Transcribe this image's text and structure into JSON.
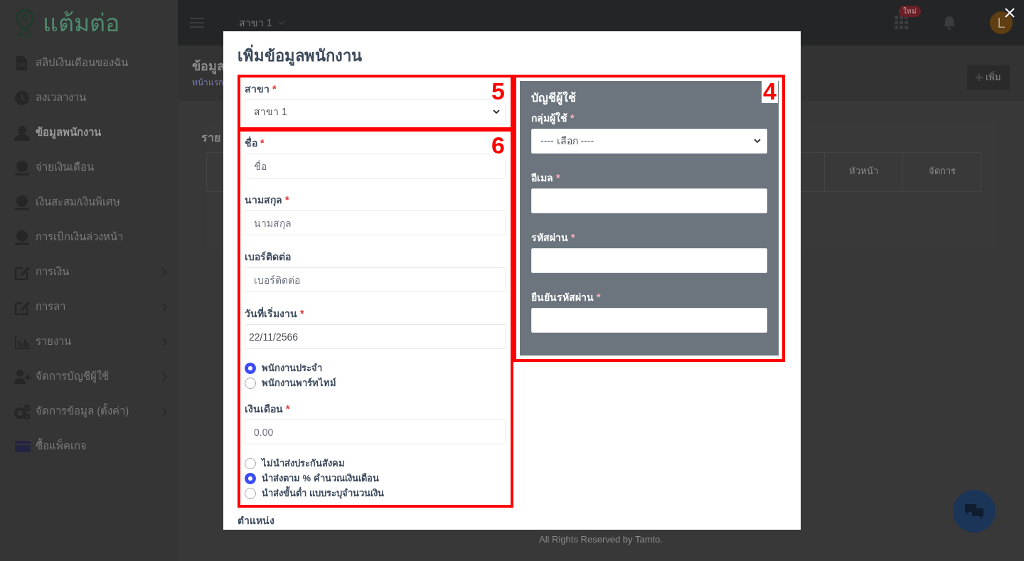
{
  "sidebar": {
    "logo": "แต้มต่อ",
    "items": [
      {
        "label": "สลิปเงินเดือนของฉัน",
        "kind": "document",
        "selected": false,
        "has_submenu": false
      },
      {
        "label": "ลงเวลางาน",
        "kind": "clock",
        "selected": false,
        "has_submenu": false
      },
      {
        "label": "ข้อมูลพนักงาน",
        "kind": "user",
        "selected": true,
        "has_submenu": false
      },
      {
        "label": "จ่ายเงินเดือน",
        "kind": "money",
        "selected": false,
        "has_submenu": false
      },
      {
        "label": "เงินสะสม/เงินพิเศษ",
        "kind": "money",
        "selected": false,
        "has_submenu": false
      },
      {
        "label": "การเบิกเงินล่วงหน้า",
        "kind": "money",
        "selected": false,
        "has_submenu": false
      },
      {
        "label": "การเงิน",
        "kind": "edit",
        "selected": false,
        "has_submenu": true
      },
      {
        "label": "การลา",
        "kind": "edit",
        "selected": false,
        "has_submenu": true
      },
      {
        "label": "รายงาน",
        "kind": "chart",
        "selected": false,
        "has_submenu": true
      },
      {
        "label": "จัดการบัญชีผู้ใช้",
        "kind": "user-plus",
        "selected": false,
        "has_submenu": true
      },
      {
        "label": "จัดการข้อมูล (ตั้งค่า)",
        "kind": "gears",
        "selected": false,
        "has_submenu": true
      },
      {
        "label": "ซื้อแพ็คเกจ",
        "kind": "card",
        "selected": false,
        "has_submenu": false
      }
    ]
  },
  "header": {
    "branch": "สาขา 1",
    "apps_badge": "ใหม่",
    "avatar": "L"
  },
  "page": {
    "title": "ข้อมูล",
    "breadcrumb": "หน้าแรก",
    "add_button": "เพิ่ม",
    "card_title": "ราย",
    "columns": [
      "หัวหน้า",
      "จัดการ"
    ],
    "footer": "All Rights Reserved by Tamto."
  },
  "modal": {
    "title": "เพิ่มข้อมูลพนักงาน",
    "branch_section": {
      "annotation": "5",
      "fields": [
        {
          "kind": "select",
          "label": "สาขา",
          "required_mark": "*",
          "value": "สาขา 1"
        }
      ]
    },
    "employee_section": {
      "annotation": "6",
      "fields": [
        {
          "kind": "input",
          "label": "ชื่อ",
          "required_mark": "*",
          "placeholder": "ชื่อ"
        },
        {
          "kind": "input",
          "label": "นามสกุล",
          "required_mark": "*",
          "placeholder": "นามสกุล"
        },
        {
          "kind": "input",
          "label": "เบอร์ติดต่อ",
          "placeholder": "เบอร์ติดต่อ"
        },
        {
          "kind": "input",
          "label": "วันที่เริ่มงาน",
          "required_mark": "*",
          "value": "22/11/2566"
        },
        {
          "kind": "radio",
          "options": [
            {
              "label": "พนักงานประจำ",
              "selected": true
            },
            {
              "label": "พนักงานพาร์ทไทม์",
              "selected": false
            }
          ]
        },
        {
          "kind": "input",
          "label": "เงินเดือน",
          "required_mark": "*",
          "placeholder": "0.00"
        },
        {
          "kind": "radio",
          "options": [
            {
              "label": "ไม่นำส่งประกันสังคม",
              "selected": false
            },
            {
              "label": "นำส่งตาม % คำนวณเงินเดือน",
              "selected": true
            },
            {
              "label": "นำส่งขั้นต่ำ แบบระบุจำนวนเงิน",
              "selected": false
            }
          ]
        }
      ]
    },
    "account_section": {
      "annotation": "4",
      "title": "บัญชีผู้ใช้",
      "fields": [
        {
          "kind": "select",
          "label": "กลุ่มผู้ใช้",
          "required_mark": "*",
          "value": "---- เลือก ----"
        },
        {
          "kind": "input",
          "label": "อีเมล",
          "required_mark": "*"
        },
        {
          "kind": "input",
          "label": "รหัสผ่าน",
          "required_mark": "*"
        },
        {
          "kind": "input",
          "label": "ยืนยันรหัสผ่าน",
          "required_mark": "*"
        }
      ]
    },
    "next_label": "ตำแหน่ง"
  }
}
